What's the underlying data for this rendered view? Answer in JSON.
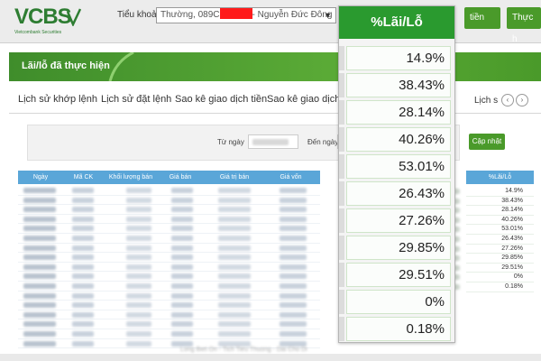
{
  "brand": {
    "logo": "VCBS",
    "tagline": "Vietcombank Securities"
  },
  "header": {
    "account_label": "Tiểu khoản",
    "account_value_prefix": "Thường, 089C",
    "account_value_suffix": "- Nguyễn Đức Đông",
    "btn_1": "tiền",
    "btn_2": "Thực h"
  },
  "title": "Lãi/lỗ đã thực hiện",
  "tabs": [
    "Lịch sử khớp lệnh",
    "Lịch sử đặt lệnh",
    "Sao kê giao dịch tiền",
    "Sao kê giao dịch ch"
  ],
  "pager": {
    "label": "Lịch s"
  },
  "filter": {
    "from_label": "Từ ngày",
    "to_label": "Đến ngày",
    "update_button": "Cập nhật"
  },
  "table": {
    "headers": [
      "Ngày",
      "Mã CK",
      "Khối lượng bán",
      "Giá bán",
      "Giá trị bán",
      "Giá vốn"
    ],
    "right_header": "%Lãi/Lỗ"
  },
  "profit_loss": [
    "14.9%",
    "38.43%",
    "28.14%",
    "40.26%",
    "53.01%",
    "26.43%",
    "27.26%",
    "29.85%",
    "29.51%",
    "0%",
    "0.18%"
  ],
  "overlay": {
    "header": "%Lãi/Lỗ"
  },
  "footer_blur": "Long Biet On - Tich Tieu Thuong - Dai Cho Di",
  "colors": {
    "brand_green": "#2a9a2f",
    "table_header_blue": "#5aa6d8",
    "redaction": "#ff1a1a"
  }
}
